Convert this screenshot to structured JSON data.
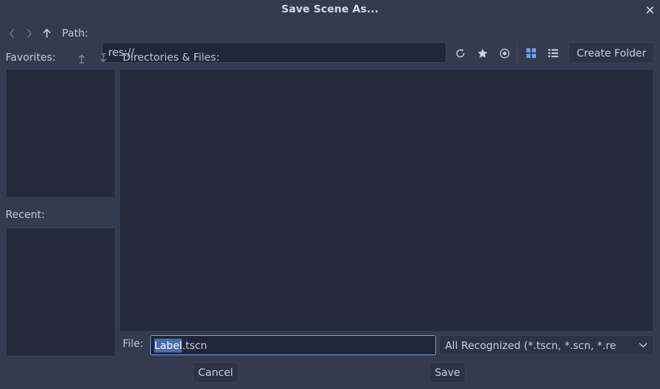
{
  "window": {
    "title": "Save Scene As...",
    "close_icon": "close-icon"
  },
  "path_bar": {
    "back_icon": "chevron-left-icon",
    "forward_icon": "chevron-right-icon",
    "up_icon": "arrow-up-icon",
    "label": "Path:",
    "value": "res://",
    "placeholder": "res://",
    "tools": [
      {
        "name": "refresh-icon",
        "label": "Refresh"
      },
      {
        "name": "star-icon",
        "label": "Toggle Favorite"
      },
      {
        "name": "eye-icon",
        "label": "Toggle Hidden Files"
      },
      {
        "name": "grid-view-icon",
        "label": "Thumbnail View",
        "active": true
      },
      {
        "name": "list-view-icon",
        "label": "List View",
        "active": false
      }
    ],
    "create_folder_label": "Create Folder"
  },
  "favorites": {
    "label": "Favorites:",
    "move_up_icon": "arrow-up-bar-icon",
    "move_down_icon": "arrow-down-bar-icon",
    "items": []
  },
  "recent": {
    "label": "Recent:",
    "items": []
  },
  "files": {
    "label": "Directories & Files:",
    "items": []
  },
  "file_row": {
    "label": "File:",
    "selected_text": "Label",
    "remaining_text": ".tscn",
    "full_value": "Label.tscn",
    "placeholder": "Label.tscn",
    "filter_value": "All Recognized (*.tscn, *.scn, *.re",
    "filter_caret_icon": "chevron-down-icon"
  },
  "actions": {
    "cancel_label": "Cancel",
    "save_label": "Save"
  },
  "colors": {
    "window_bg": "#333b4f",
    "panel_bg": "#262b3b",
    "input_bg": "#21263a",
    "border": "#3a4157",
    "text": "#c7cbd6",
    "accent": "#6f9eeb",
    "focus_border": "#7ba4e8",
    "selection_bg": "#4a6da8"
  }
}
